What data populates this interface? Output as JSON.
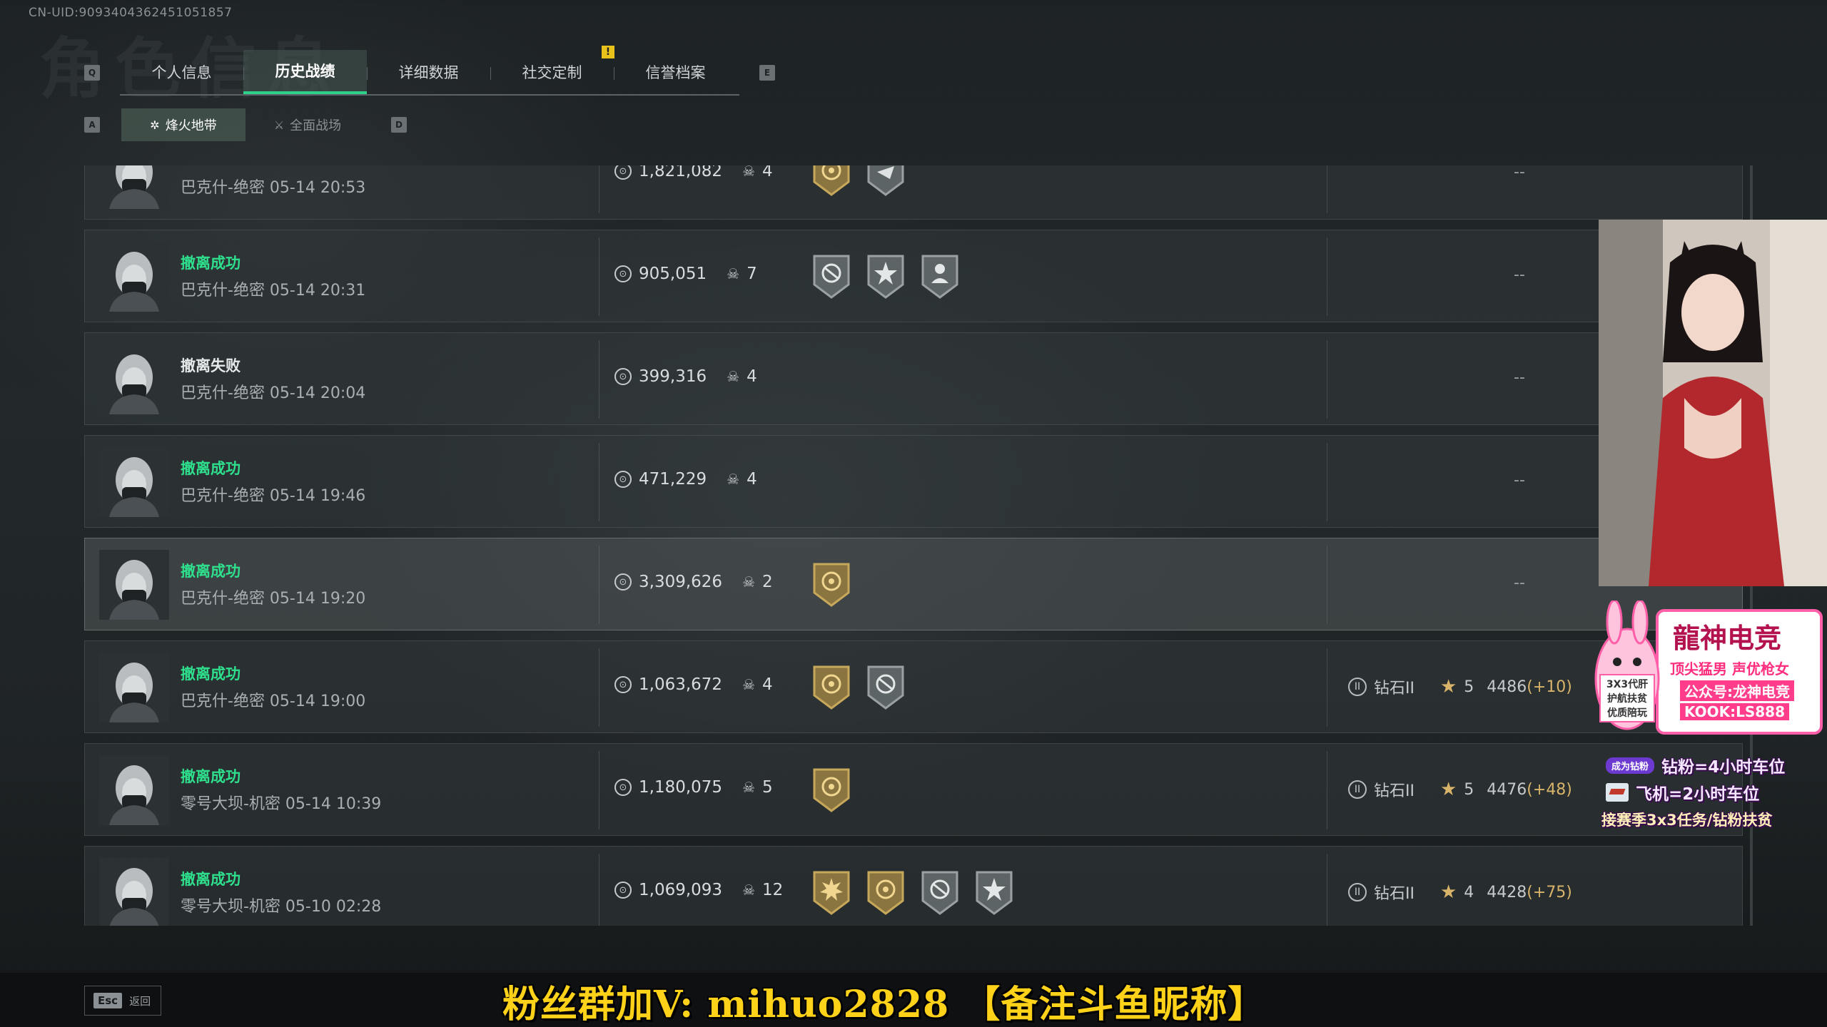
{
  "uid": "CN-UID:9093404362451051857",
  "ghost_title": "角色信息",
  "key_hints": {
    "prev_tab": "Q",
    "next_tab": "E",
    "prev_sub": "A",
    "next_sub": "D"
  },
  "tabs": [
    {
      "label": "个人信息",
      "active": false
    },
    {
      "label": "历史战绩",
      "active": true
    },
    {
      "label": "详细数据",
      "active": false
    },
    {
      "label": "社交定制",
      "active": false
    },
    {
      "label": "信誉档案",
      "active": false
    }
  ],
  "alert_badge": "!",
  "subtabs": [
    {
      "label": "烽火地带",
      "icon": "beacon-icon",
      "active": true
    },
    {
      "label": "全面战场",
      "icon": "battlefield-icon",
      "active": false
    }
  ],
  "records": [
    {
      "status": "",
      "map": "巴克什-绝密 05-14 20:53",
      "value": "1,821,082",
      "kills": "4",
      "badges": [
        "gold-shield",
        "silver-emblem"
      ],
      "rank": null,
      "result": "--"
    },
    {
      "status": "撤离成功",
      "map": "巴克什-绝密 05-14 20:31",
      "value": "905,051",
      "kills": "7",
      "badges": [
        "silver-rotation",
        "silver-star",
        "silver-soldier"
      ],
      "rank": null,
      "result": "--"
    },
    {
      "status": "撤离失败",
      "map": "巴克什-绝密 05-14 20:04",
      "value": "399,316",
      "kills": "4",
      "badges": [],
      "rank": null,
      "result": "--"
    },
    {
      "status": "撤离成功",
      "map": "巴克什-绝密 05-14 19:46",
      "value": "471,229",
      "kills": "4",
      "badges": [],
      "rank": null,
      "result": "--"
    },
    {
      "status": "撤离成功",
      "map": "巴克什-绝密 05-14 19:20",
      "value": "3,309,626",
      "kills": "2",
      "badges": [
        "gold-shield"
      ],
      "rank": null,
      "result": "--"
    },
    {
      "status": "撤离成功",
      "map": "巴克什-绝密 05-14 19:00",
      "value": "1,063,672",
      "kills": "4",
      "badges": [
        "gold-shield",
        "silver-rotation"
      ],
      "rank": {
        "tier": "钻石II",
        "stars": "5",
        "score": "4486",
        "delta": "(+10)"
      },
      "result": null
    },
    {
      "status": "撤离成功",
      "map": "零号大坝-机密 05-14 10:39",
      "value": "1,180,075",
      "kills": "5",
      "badges": [
        "gold-shield"
      ],
      "rank": {
        "tier": "钻石II",
        "stars": "5",
        "score": "4476",
        "delta": "(+48)"
      },
      "result": null
    },
    {
      "status": "撤离成功",
      "map": "零号大坝-机密 05-10 02:28",
      "value": "1,069,093",
      "kills": "12",
      "badges": [
        "gold-sun",
        "gold-shield",
        "silver-rotation",
        "silver-star"
      ],
      "rank": {
        "tier": "钻石II",
        "stars": "4",
        "score": "4428",
        "delta": "(+75)"
      },
      "result": null
    }
  ],
  "back": {
    "key": "Esc",
    "label": "返回"
  },
  "stream_overlay": {
    "promo_banner": "粉丝群加V: mihuo2828 【备注斗鱼昵称】",
    "brand_name": "龍神电竞",
    "brand_slogan": "顶尖猛男 声优枪女",
    "brand_account": "公众号:龙神电竞",
    "brand_kook": "KOOK:LS888",
    "brand_side_text": "3X3代肝 护航扶贫 优质陪玩",
    "tag_label": "成为钻粉",
    "line1": "钻粉=4小时车位",
    "line2": "飞机=2小时车位",
    "line3": "接赛季3x3任务/钻粉扶贫"
  },
  "colors": {
    "success": "#2ee08d",
    "accent_tab": "#2fd08a",
    "gold": "#d8b36a",
    "promo": "#ffd21a"
  }
}
